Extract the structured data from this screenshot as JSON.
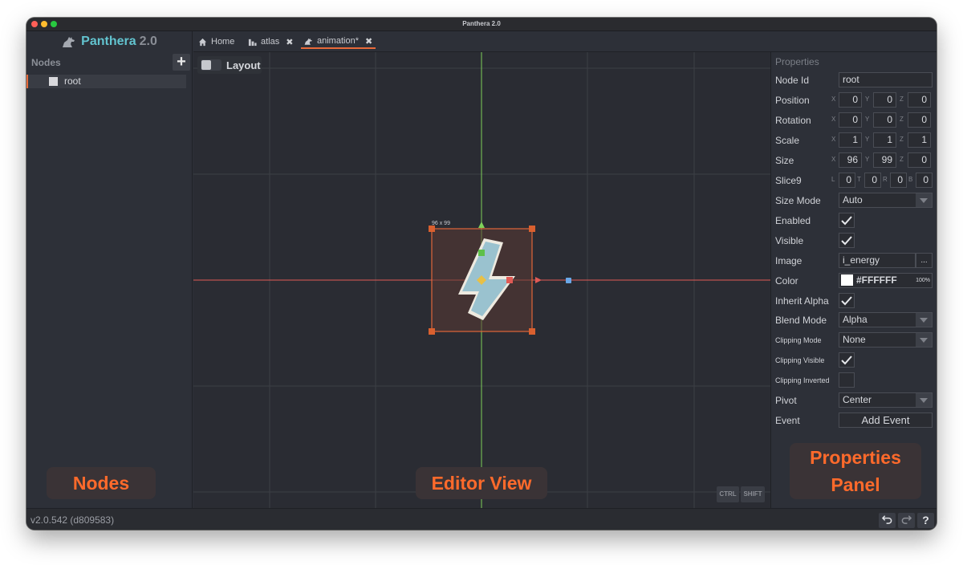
{
  "window": {
    "title": "Panthera 2.0"
  },
  "app": {
    "name": "Panthera",
    "version_tag": "2.0",
    "logo_icon": "panther-icon"
  },
  "nodes_panel": {
    "header": "Nodes",
    "add_label": "+",
    "items": [
      {
        "label": "root"
      }
    ]
  },
  "tabs": [
    {
      "label": "Home",
      "icon": "home-icon",
      "closable": false
    },
    {
      "label": "atlas",
      "icon": "atlas-icon",
      "closable": true
    },
    {
      "label": "animation*",
      "icon": "panther-icon",
      "closable": true,
      "active": true
    }
  ],
  "tab_close": "✖",
  "editor": {
    "layout_label": "Layout",
    "selection_size": "96 x 99",
    "key_ctrl": "CTRL",
    "key_shift": "SHIFT",
    "image_icon": "lightning-bolt-icon"
  },
  "overlays": {
    "nodes": "Nodes Panel",
    "editor": "Editor View",
    "props_line1": "Properties",
    "props_line2": "Panel"
  },
  "properties": {
    "title": "Properties",
    "node_id": {
      "label": "Node Id",
      "value": "root"
    },
    "position": {
      "label": "Position",
      "x": "0",
      "y": "0",
      "z": "0"
    },
    "rotation": {
      "label": "Rotation",
      "x": "0",
      "y": "0",
      "z": "0"
    },
    "scale": {
      "label": "Scale",
      "x": "1",
      "y": "1",
      "z": "1"
    },
    "size": {
      "label": "Size",
      "x": "96",
      "y": "99",
      "z": "0"
    },
    "slice9": {
      "label": "Slice9",
      "l": "0",
      "t": "0",
      "r": "0",
      "b": "0"
    },
    "size_mode": {
      "label": "Size Mode",
      "value": "Auto"
    },
    "enabled": {
      "label": "Enabled",
      "checked": true
    },
    "visible": {
      "label": "Visible",
      "checked": true
    },
    "image": {
      "label": "Image",
      "value": "i_energy",
      "browse": "..."
    },
    "color": {
      "label": "Color",
      "value": "#FFFFFF",
      "alpha": "100%",
      "swatch": "#ffffff"
    },
    "inherit_alpha": {
      "label": "Inherit Alpha",
      "checked": true
    },
    "blend_mode": {
      "label": "Blend Mode",
      "value": "Alpha"
    },
    "clipping_mode": {
      "label": "Clipping Mode",
      "value": "None"
    },
    "clipping_visible": {
      "label": "Clipping Visible",
      "checked": true
    },
    "clipping_inverted": {
      "label": "Clipping Inverted",
      "checked": false
    },
    "pivot": {
      "label": "Pivot",
      "value": "Center"
    },
    "event": {
      "label": "Event",
      "button": "Add Event"
    },
    "axis": {
      "x": "X",
      "y": "Y",
      "z": "Z",
      "l": "L",
      "t": "T",
      "r": "R",
      "b": "B"
    }
  },
  "status": {
    "version": "v2.0.542 (d809583)",
    "undo_icon": "undo-icon",
    "redo_icon": "redo-icon",
    "help_label": "?"
  },
  "colors": {
    "accent": "#e86a3a",
    "overlay_text": "#ff6a2b",
    "logo": "#62c3cf",
    "x_axis": "#e05a55",
    "y_axis": "#7fd15a"
  }
}
